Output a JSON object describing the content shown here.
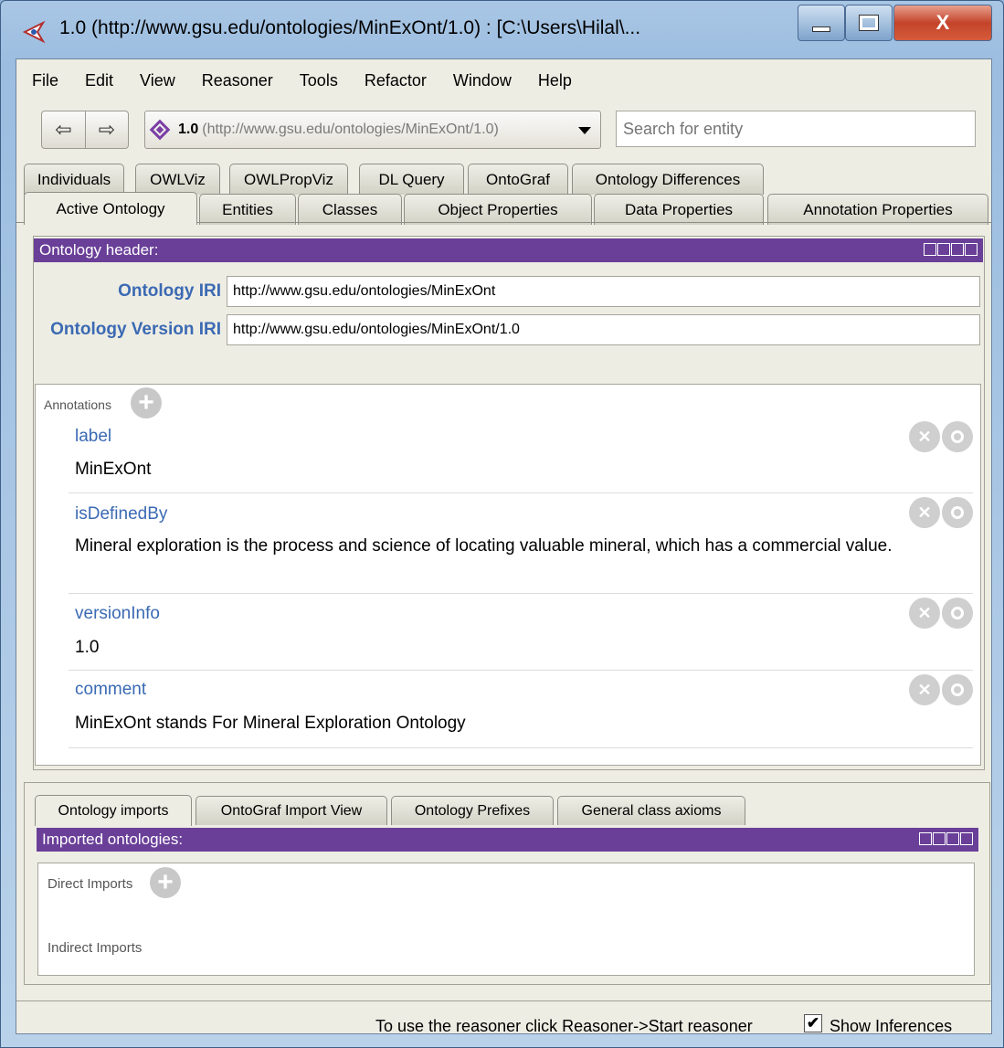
{
  "window": {
    "title": "1.0 (http://www.gsu.edu/ontologies/MinExOnt/1.0)  : [C:\\Users\\Hilal\\...",
    "close_glyph": "X"
  },
  "menu": [
    "File",
    "Edit",
    "View",
    "Reasoner",
    "Tools",
    "Refactor",
    "Window",
    "Help"
  ],
  "toolbar": {
    "back_glyph": "⇦",
    "forward_glyph": "⇨",
    "ontology_version": "1.0",
    "ontology_iri": "(http://www.gsu.edu/ontologies/MinExOnt/1.0)",
    "search_placeholder": "Search for entity"
  },
  "tabs_row1": [
    "Individuals",
    "OWLViz",
    "OWLPropViz",
    "DL Query",
    "OntoGraf",
    "Ontology Differences"
  ],
  "tabs_row2": [
    "Active Ontology",
    "Entities",
    "Classes",
    "Object Properties",
    "Data Properties",
    "Annotation Properties"
  ],
  "header_panel": {
    "title": "Ontology header:",
    "iri_label": "Ontology IRI",
    "iri_value": "http://www.gsu.edu/ontologies/MinExOnt",
    "version_label": "Ontology Version IRI",
    "version_value": "http://www.gsu.edu/ontologies/MinExOnt/1.0"
  },
  "annotations": {
    "title": "Annotations",
    "items": [
      {
        "property": "label",
        "value": "MinExOnt"
      },
      {
        "property": "isDefinedBy",
        "value": "Mineral exploration is the process and science of locating valuable mineral, which has a commercial value."
      },
      {
        "property": "versionInfo",
        "value": "1.0"
      },
      {
        "property": "comment",
        "value": "MinExOnt stands For Mineral Exploration Ontology"
      }
    ]
  },
  "lower_tabs": [
    "Ontology imports",
    "OntoGraf Import View",
    "Ontology Prefixes",
    "General class axioms"
  ],
  "imports_panel": {
    "title": "Imported ontologies:",
    "direct": "Direct Imports",
    "indirect": "Indirect Imports"
  },
  "status": {
    "message": "To use the reasoner click Reasoner->Start reasoner",
    "show_inferences_label": "Show Inferences",
    "show_inferences_checked": true,
    "check_glyph": "✔"
  },
  "colors": {
    "panel_header": "#6a3f98",
    "property_link": "#3b6ab3"
  }
}
